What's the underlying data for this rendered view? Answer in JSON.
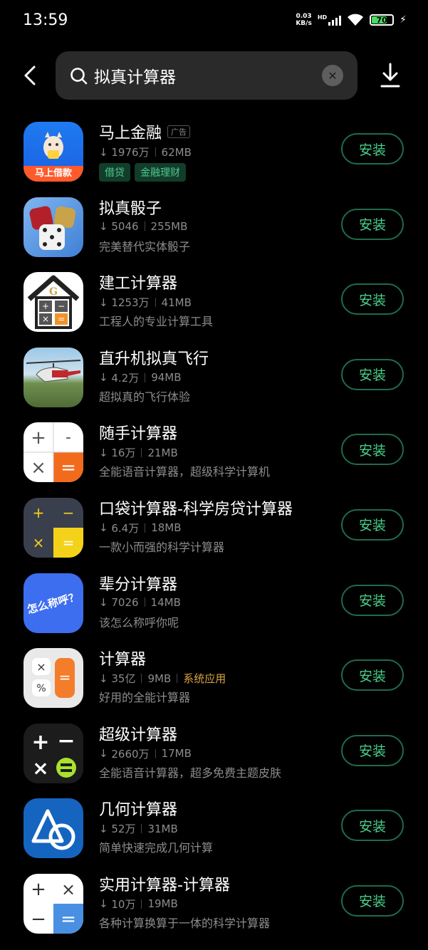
{
  "status_bar": {
    "time": "13:59",
    "net_speed": "0.03",
    "net_unit": "KB/s",
    "hd": "HD",
    "battery": "70"
  },
  "search": {
    "query": "拟真计算器"
  },
  "colors": {
    "accent": "#49d08c",
    "background": "#000000"
  },
  "apps": [
    {
      "name": "马上金融",
      "ad": "广告",
      "downloads": "1976万",
      "size": "62MB",
      "tags": [
        "借贷",
        "金融理财"
      ],
      "icon": "mashang-loan-icon",
      "icon_text": "马上借款",
      "button": "安装"
    },
    {
      "name": "拟真骰子",
      "downloads": "5046",
      "size": "255MB",
      "desc": "完美替代实体骰子",
      "icon": "dice-icon",
      "button": "安装"
    },
    {
      "name": "建工计算器",
      "downloads": "1253万",
      "size": "41MB",
      "desc": "工程人的专业计算工具",
      "icon": "house-calculator-icon",
      "button": "安装"
    },
    {
      "name": "直升机拟真飞行",
      "downloads": "4.2万",
      "size": "94MB",
      "desc": "超拟真的飞行体验",
      "icon": "helicopter-icon",
      "button": "安装"
    },
    {
      "name": "随手计算器",
      "downloads": "16万",
      "size": "21MB",
      "desc": "全能语音计算器，超级科学计算机",
      "icon": "white-calculator-icon",
      "button": "安装"
    },
    {
      "name": "口袋计算器-科学房贷计算器",
      "downloads": "6.4万",
      "size": "18MB",
      "desc": "一款小而强的科学计算器",
      "icon": "pocket-calculator-icon",
      "button": "安装"
    },
    {
      "name": "辈分计算器",
      "downloads": "7026",
      "size": "14MB",
      "desc": "该怎么称呼你呢",
      "icon": "kinship-icon",
      "icon_text": "怎么称呼？",
      "button": "安装"
    },
    {
      "name": "计算器",
      "downloads": "35亿",
      "size": "9MB",
      "system": "系统应用",
      "desc": "好用的全能计算器",
      "icon": "system-calculator-icon",
      "button": "安装"
    },
    {
      "name": "超级计算器",
      "downloads": "2660万",
      "size": "17MB",
      "desc": "全能语音计算器，超多免费主题皮肤",
      "icon": "super-calculator-icon",
      "button": "安装"
    },
    {
      "name": "几何计算器",
      "downloads": "52万",
      "size": "31MB",
      "desc": "简单快速完成几何计算",
      "icon": "geometry-icon",
      "button": "安装"
    },
    {
      "name": "实用计算器-计算器",
      "downloads": "10万",
      "size": "19MB",
      "desc": "各种计算换算于一体的科学计算器",
      "icon": "practical-calculator-icon",
      "button": "安装"
    }
  ]
}
